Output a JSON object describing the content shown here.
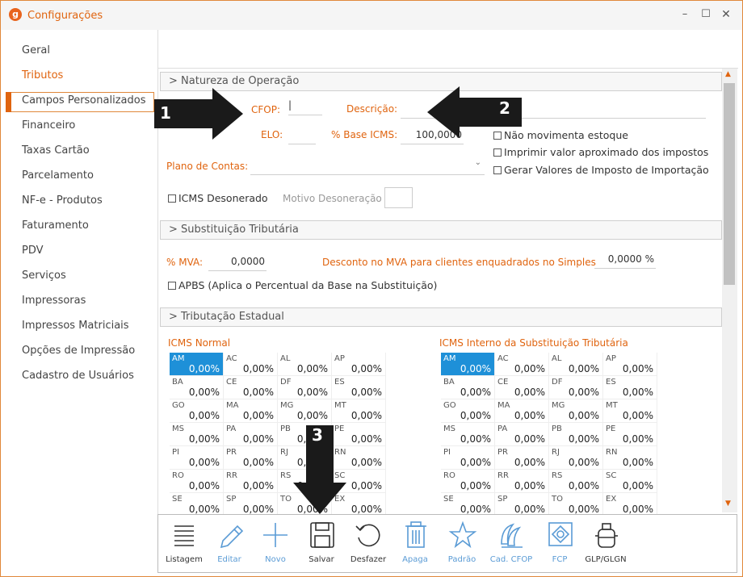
{
  "window": {
    "title": "Configurações",
    "logo": "g"
  },
  "sidebar": {
    "items": [
      {
        "label": "Geral"
      },
      {
        "label": "Tributos"
      },
      {
        "label": "Campos Personalizados"
      },
      {
        "label": "Financeiro"
      },
      {
        "label": "Taxas Cartão"
      },
      {
        "label": "Parcelamento"
      },
      {
        "label": "NF-e - Produtos"
      },
      {
        "label": "Faturamento"
      },
      {
        "label": "PDV"
      },
      {
        "label": "Serviços"
      },
      {
        "label": "Impressoras"
      },
      {
        "label": "Impressos Matriciais"
      },
      {
        "label": "Opções de Impressão"
      },
      {
        "label": "Cadastro de Usuários"
      }
    ],
    "selected": "Tributos"
  },
  "natureza": {
    "header": "> Natureza de Operação",
    "cfop_label": "CFOP:",
    "cfop_value": "|",
    "descricao_label": "Descrição:",
    "elo_label": "ELO:",
    "base_icms_label": "% Base ICMS:",
    "base_icms_value": "100,0000",
    "plano_label": "Plano de Contas:",
    "chk_estoque": "Não movimenta estoque",
    "chk_imprimir": "Imprimir valor aproximado dos impostos",
    "chk_importacao": "Gerar Valores de Imposto de Importação",
    "chk_desonerado": "ICMS Desonerado",
    "motivo_label": "Motivo Desoneração"
  },
  "subst": {
    "header": "> Substituição Tributária",
    "mva_label": "% MVA:",
    "mva_value": "0,0000",
    "desconto_label": "Desconto no MVA para clientes enquadrados no Simples",
    "desconto_value": "0,0000 %",
    "apbs": "APBS (Aplica o Percentual da Base na Substituição)"
  },
  "estadual": {
    "header": "> Tributação Estadual",
    "icms_normal_title": "ICMS Normal",
    "icms_interno_title": "ICMS Interno da Substituição Tributária",
    "states": [
      "AM",
      "AC",
      "AL",
      "AP",
      "BA",
      "CE",
      "DF",
      "ES",
      "GO",
      "MA",
      "MG",
      "MT",
      "MS",
      "PA",
      "PB",
      "PE",
      "PI",
      "PR",
      "RJ",
      "RN",
      "RO",
      "RR",
      "RS",
      "SC",
      "SE",
      "SP",
      "TO",
      "EX"
    ],
    "cell_value": "0,00%"
  },
  "toolbar": {
    "buttons": [
      {
        "label": "Listagem",
        "icon": "list-icon",
        "color": "#333333"
      },
      {
        "label": "Editar",
        "icon": "pencil-icon",
        "color": "#5a9bd5"
      },
      {
        "label": "Novo",
        "icon": "plus-icon",
        "color": "#5a9bd5"
      },
      {
        "label": "Salvar",
        "icon": "floppy-icon",
        "color": "#333333"
      },
      {
        "label": "Desfazer",
        "icon": "undo-icon",
        "color": "#333333"
      },
      {
        "label": "Apaga",
        "icon": "trash-icon",
        "color": "#5a9bd5"
      },
      {
        "label": "Padrão",
        "icon": "star-icon",
        "color": "#5a9bd5"
      },
      {
        "label": "Cad. CFOP",
        "icon": "cfop-icon",
        "color": "#5a9bd5"
      },
      {
        "label": "FCP",
        "icon": "fcp-icon",
        "color": "#5a9bd5"
      },
      {
        "label": "GLP/GLGN",
        "icon": "gas-cylinder-icon",
        "color": "#333333"
      }
    ]
  },
  "annotations": {
    "n1": "1",
    "n2": "2",
    "n3": "3"
  }
}
